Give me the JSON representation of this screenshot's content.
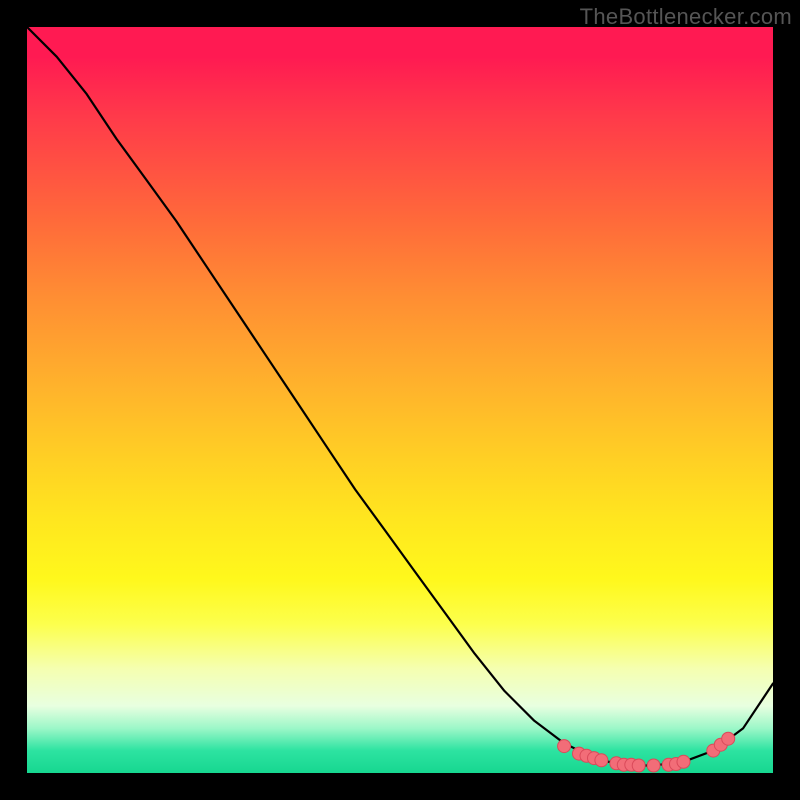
{
  "watermark": "TheBottlenecker.com",
  "chart_data": {
    "type": "line",
    "title": "",
    "xlabel": "",
    "ylabel": "",
    "xlim": [
      0,
      100
    ],
    "ylim": [
      0,
      100
    ],
    "x": [
      0,
      4,
      8,
      12,
      16,
      20,
      24,
      28,
      32,
      36,
      40,
      44,
      48,
      52,
      56,
      60,
      64,
      68,
      72,
      76,
      80,
      84,
      88,
      92,
      96,
      100
    ],
    "y": [
      100,
      96,
      91,
      85,
      79.5,
      74,
      68,
      62,
      56,
      50,
      44,
      38,
      32.5,
      27,
      21.5,
      16,
      11,
      7,
      4,
      2,
      1,
      1,
      1.5,
      3,
      6,
      12
    ],
    "marker_points": {
      "x": [
        72,
        74,
        75,
        76,
        77,
        79,
        80,
        81,
        82,
        84,
        86,
        87,
        88,
        92,
        93,
        94
      ],
      "y": [
        3.6,
        2.6,
        2.3,
        2.0,
        1.7,
        1.3,
        1.1,
        1.1,
        1.0,
        1.0,
        1.1,
        1.2,
        1.5,
        3,
        3.8,
        4.6
      ]
    },
    "colors": {
      "line": "#000000",
      "marker_fill": "#f26d78",
      "marker_stroke": "#da4a5a"
    }
  }
}
